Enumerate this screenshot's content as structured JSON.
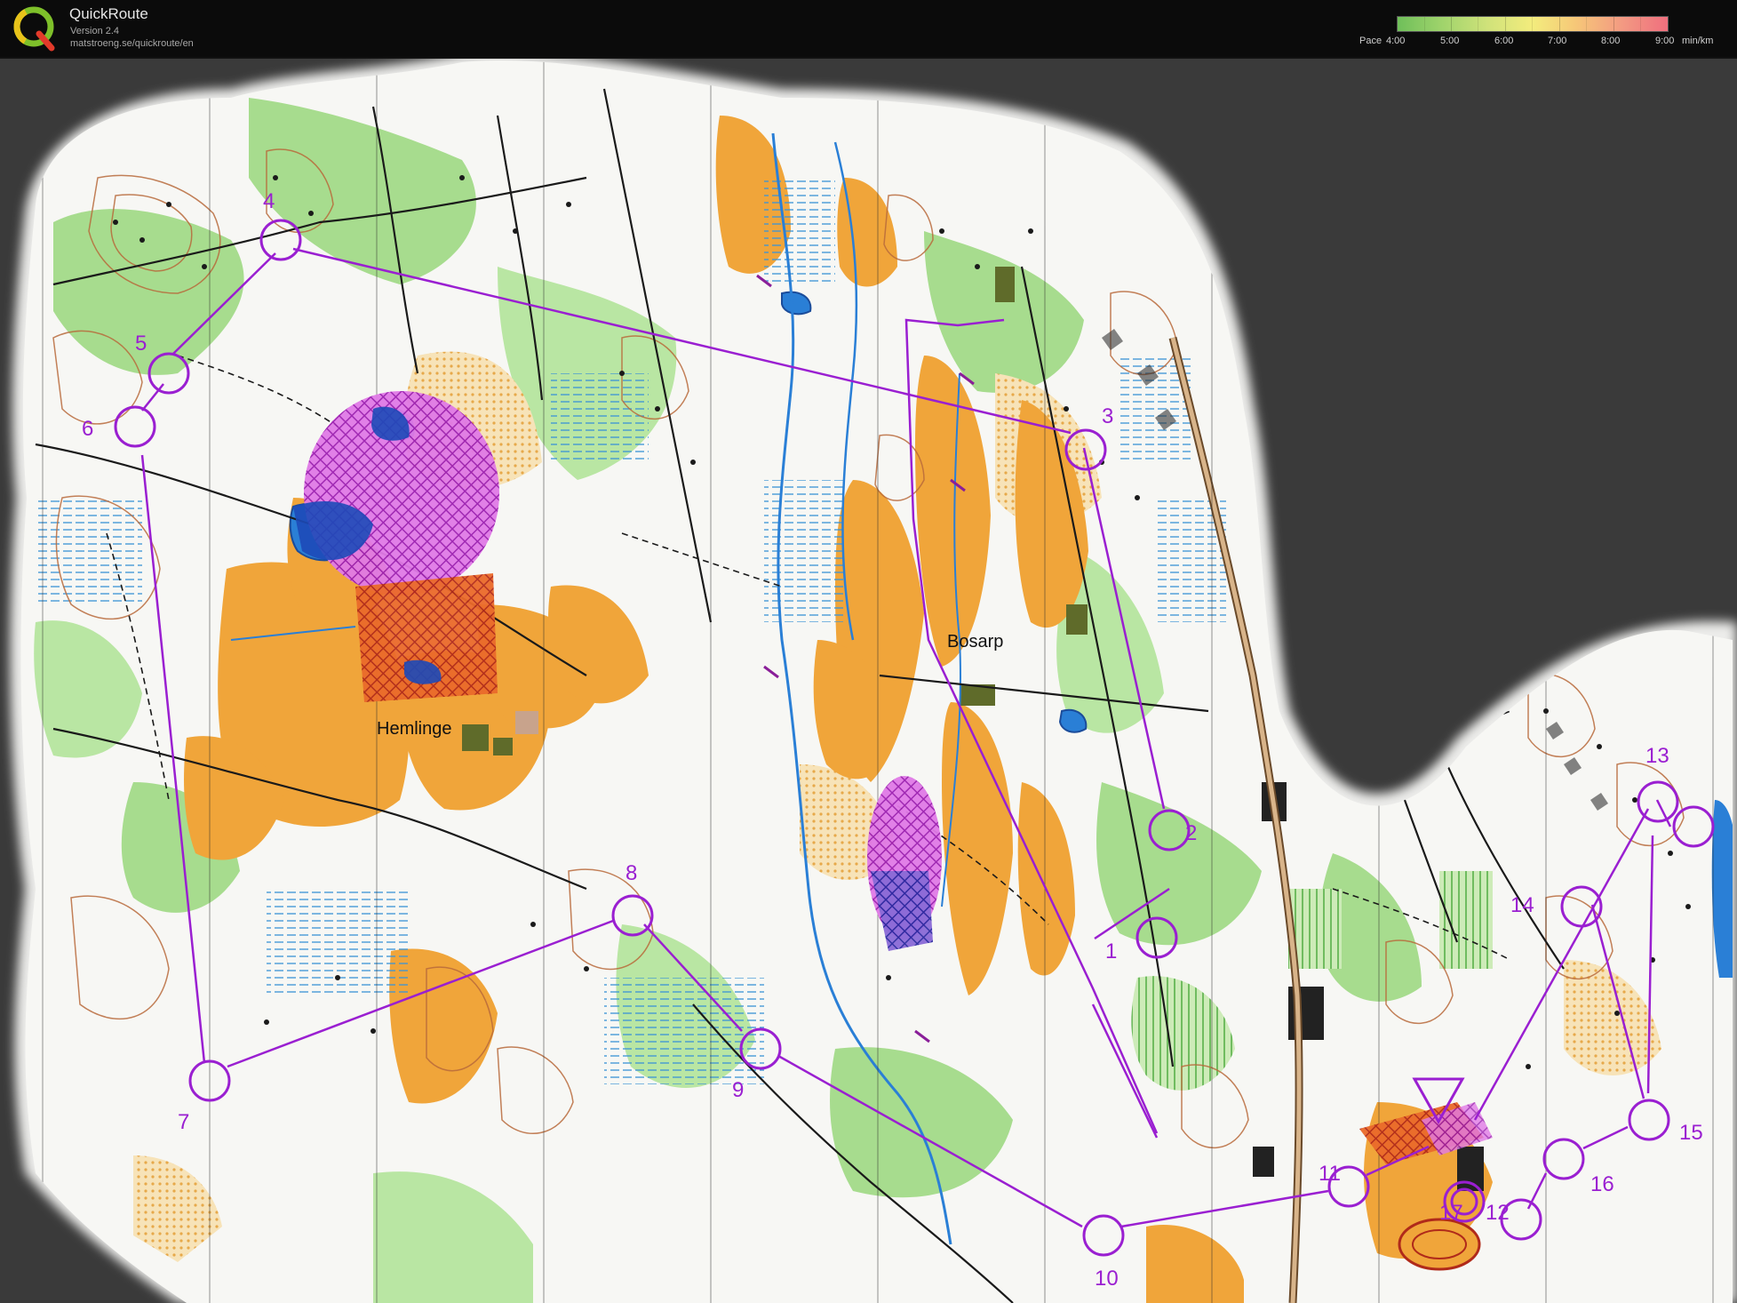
{
  "app": {
    "title": "QuickRoute",
    "version": "Version 2.4",
    "url": "matstroeng.se/quickroute/en",
    "logo_letter": "Q"
  },
  "pace_legend": {
    "prefix": "Pace",
    "ticks": [
      "4:00",
      "5:00",
      "6:00",
      "7:00",
      "8:00",
      "9:00"
    ],
    "unit": "min/km",
    "colors": [
      "#6fbf5a",
      "#cfe27a",
      "#f3ec7d",
      "#f6c778",
      "#f39a82",
      "#ef6f7e"
    ]
  },
  "map": {
    "place_names": [
      "Hemlinge",
      "Bosarp"
    ],
    "control_numbers": [
      "1",
      "2",
      "3",
      "4",
      "5",
      "6",
      "7",
      "8",
      "9",
      "10",
      "11",
      "12",
      "13",
      "14",
      "15",
      "16",
      "17"
    ],
    "course_color": "#9a1fd1",
    "colors": {
      "open_land": "#f0a53a",
      "forest_green": "#8fd07a",
      "white_forest": "#f7f7f4",
      "contour_brown": "#b86a3b",
      "water_blue": "#2a7fd6",
      "out_of_bounds_magenta": "#c02ad0",
      "background": "#3a3a3a"
    }
  }
}
